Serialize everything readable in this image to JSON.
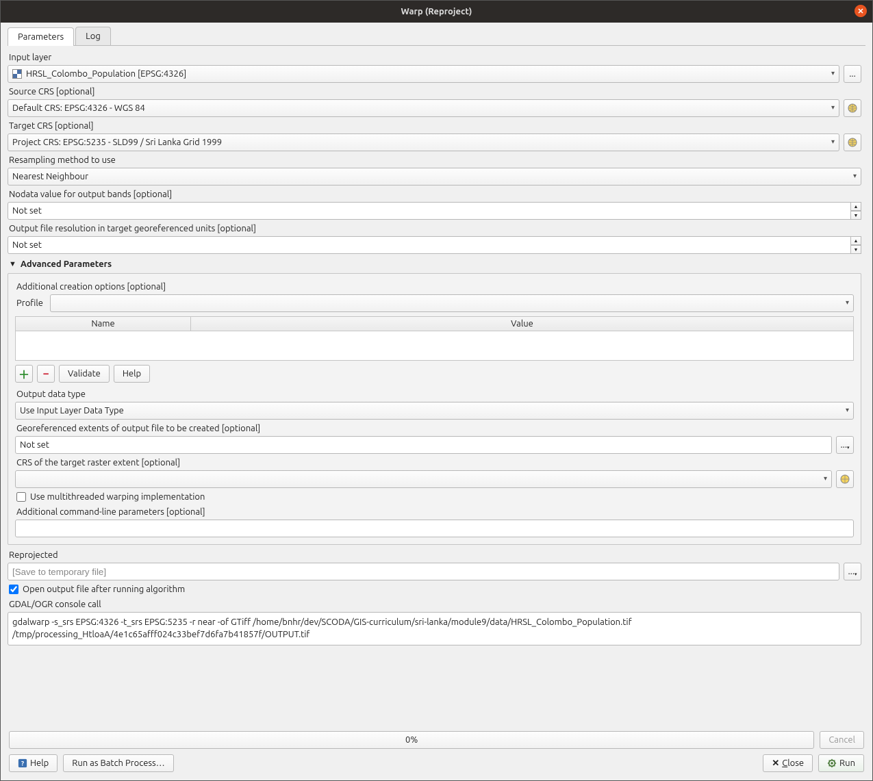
{
  "window": {
    "title": "Warp (Reproject)"
  },
  "tabs": {
    "parameters": "Parameters",
    "log": "Log"
  },
  "labels": {
    "input_layer": "Input layer",
    "source_crs": "Source CRS [optional]",
    "target_crs": "Target CRS [optional]",
    "resampling": "Resampling method to use",
    "nodata": "Nodata value for output bands [optional]",
    "out_res": "Output file resolution in target georeferenced units [optional]",
    "advanced": "Advanced Parameters",
    "add_creation": "Additional creation options [optional]",
    "profile": "Profile",
    "name_col": "Name",
    "value_col": "Value",
    "out_dtype": "Output data type",
    "geo_extents": "Georeferenced extents of output file to be created [optional]",
    "crs_target_extent": "CRS of the target raster extent [optional]",
    "multithread": "Use multithreaded warping implementation",
    "add_cmd": "Additional command-line parameters [optional]",
    "reprojected": "Reprojected",
    "open_after": "Open output file after running algorithm",
    "gdal_call": "GDAL/OGR console call"
  },
  "values": {
    "input_layer": "HRSL_Colombo_Population [EPSG:4326]",
    "source_crs": "Default CRS: EPSG:4326 - WGS 84",
    "target_crs": "Project CRS: EPSG:5235 - SLD99 / Sri Lanka Grid 1999",
    "resampling": "Nearest Neighbour",
    "nodata": "Not set",
    "out_res": "Not set",
    "out_dtype": "Use Input Layer Data Type",
    "geo_extents": "Not set",
    "reprojected_placeholder": "[Save to temporary file]",
    "gdal_cmd": "gdalwarp -s_srs EPSG:4326 -t_srs EPSG:5235 -r near -of GTiff /home/bnhr/dev/SCODA/GIS-curriculum/sri-lanka/module9/data/HRSL_Colombo_Population.tif /tmp/processing_HtloaA/4e1c65afff024c33bef7d6fa7b41857f/OUTPUT.tif"
  },
  "buttons": {
    "validate": "Validate",
    "help_small": "Help",
    "browse": "...",
    "cancel": "Cancel",
    "help": "Help",
    "batch": "Run as Batch Process…",
    "close": "Close",
    "run": "Run"
  },
  "progress": {
    "text": "0%"
  },
  "checks": {
    "multithread": false,
    "open_after": true
  }
}
